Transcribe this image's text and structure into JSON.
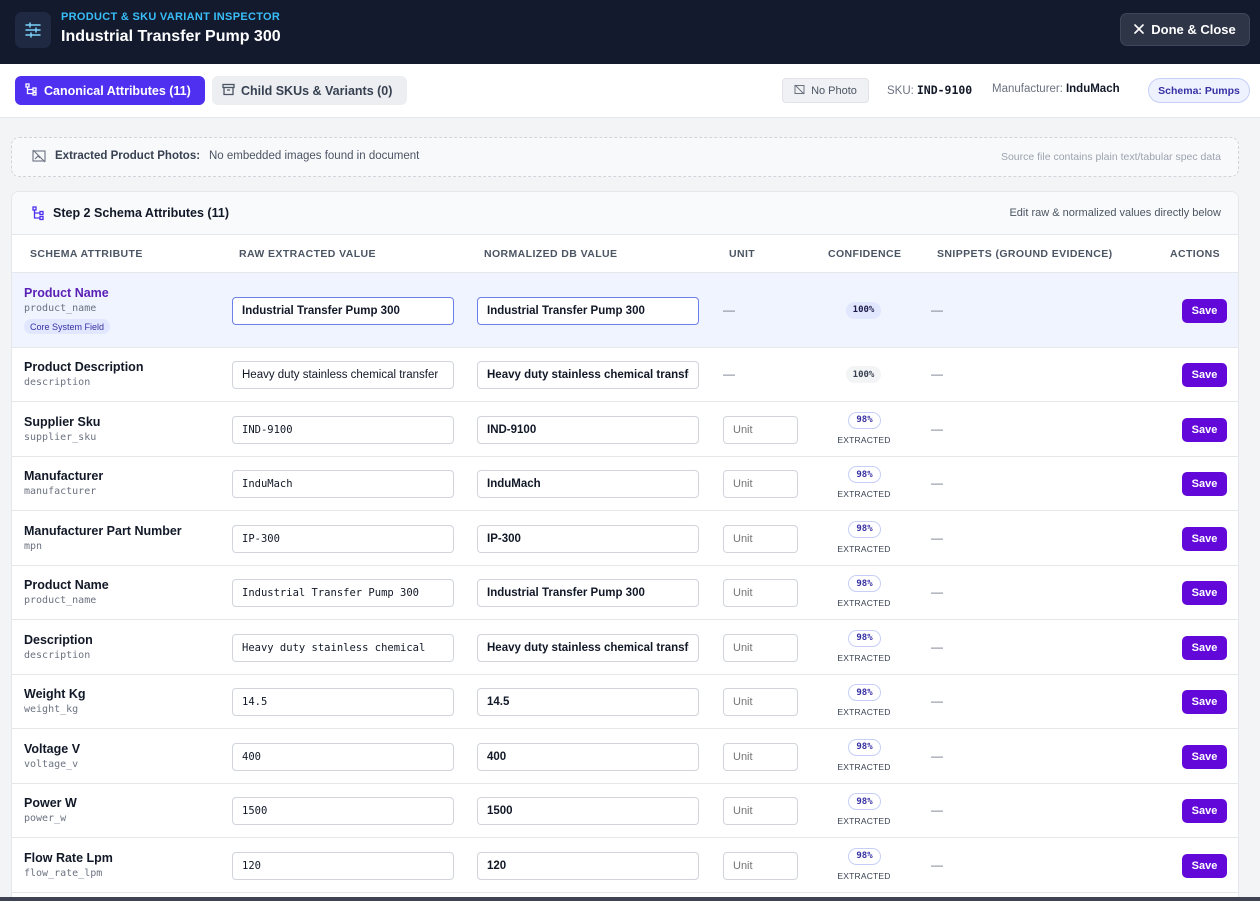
{
  "header": {
    "eyebrow": "PRODUCT & SKU VARIANT INSPECTOR",
    "title": "Industrial Transfer Pump 300",
    "close_label": "Done & Close"
  },
  "toolbar": {
    "tab_canonical": "Canonical Attributes (11)",
    "tab_children": "Child SKUs & Variants (0)",
    "no_photo": "No Photo",
    "sku_label": "SKU:",
    "sku_value": "IND-9100",
    "manufacturer_label": "Manufacturer:",
    "manufacturer_value": "InduMach",
    "schema_badge": "Schema: Pumps"
  },
  "photos": {
    "label": "Extracted Product Photos:",
    "value": "No embedded images found in document",
    "note": "Source file contains plain text/tabular spec data"
  },
  "card": {
    "title": "Step 2 Schema Attributes (11)",
    "note": "Edit raw & normalized values directly below"
  },
  "columns": [
    "SCHEMA ATTRIBUTE",
    "RAW EXTRACTED VALUE",
    "NORMALIZED DB VALUE",
    "UNIT",
    "CONFIDENCE",
    "SNIPPETS (GROUND EVIDENCE)",
    "ACTIONS"
  ],
  "unit_placeholder": "Unit",
  "save_label": "Save",
  "dash": "—",
  "extracted_label": "EXTRACTED",
  "core_badge": "Core System Field",
  "rows": [
    {
      "name": "Product Name",
      "key": "product_name",
      "raw": "Industrial Transfer Pump 300",
      "norm": "Industrial Transfer Pump 300",
      "confidence": "100%"
    },
    {
      "name": "Product Description",
      "key": "description",
      "raw": "Heavy duty stainless chemical transfer",
      "norm": "Heavy duty stainless chemical transfer",
      "confidence": "100%"
    },
    {
      "name": "Supplier Sku",
      "key": "supplier_sku",
      "raw": "IND-9100",
      "norm": "IND-9100",
      "confidence": "98%"
    },
    {
      "name": "Manufacturer",
      "key": "manufacturer",
      "raw": "InduMach",
      "norm": "InduMach",
      "confidence": "98%"
    },
    {
      "name": "Manufacturer Part Number",
      "key": "mpn",
      "raw": "IP-300",
      "norm": "IP-300",
      "confidence": "98%"
    },
    {
      "name": "Product Name",
      "key": "product_name",
      "raw": "Industrial Transfer Pump 300",
      "norm": "Industrial Transfer Pump 300",
      "confidence": "98%"
    },
    {
      "name": "Description",
      "key": "description",
      "raw": "Heavy duty stainless chemical",
      "norm": "Heavy duty stainless chemical transfer",
      "confidence": "98%"
    },
    {
      "name": "Weight Kg",
      "key": "weight_kg",
      "raw": "14.5",
      "norm": "14.5",
      "confidence": "98%"
    },
    {
      "name": "Voltage V",
      "key": "voltage_v",
      "raw": "400",
      "norm": "400",
      "confidence": "98%"
    },
    {
      "name": "Power W",
      "key": "power_w",
      "raw": "1500",
      "norm": "1500",
      "confidence": "98%"
    },
    {
      "name": "Flow Rate Lpm",
      "key": "flow_rate_lpm",
      "raw": "120",
      "norm": "120",
      "confidence": "98%"
    }
  ]
}
